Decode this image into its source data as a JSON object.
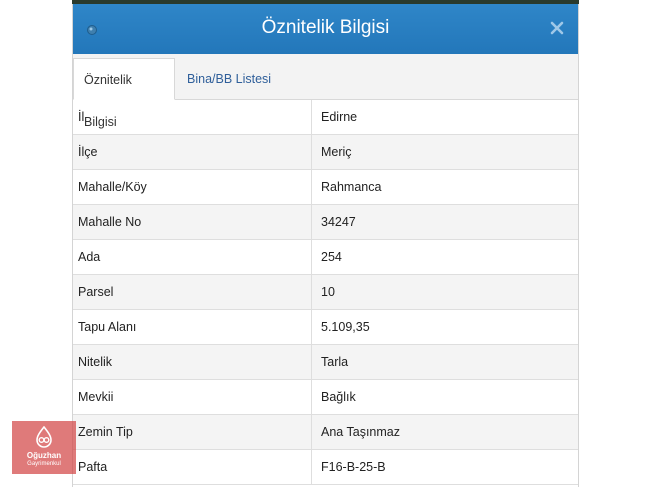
{
  "dialog": {
    "title": "Öznitelik Bilgisi",
    "close_icon": "close-icon",
    "title_icon": "globe-icon",
    "accent_color": "#2a7cbf"
  },
  "tabs": [
    {
      "label": "Öznitelik Bilgisi",
      "active": true
    },
    {
      "label": "Bina/BB Listesi",
      "active": false
    }
  ],
  "attributes": [
    {
      "key": "İl",
      "value": "Edirne"
    },
    {
      "key": "İlçe",
      "value": "Meriç"
    },
    {
      "key": "Mahalle/Köy",
      "value": "Rahmanca"
    },
    {
      "key": "Mahalle No",
      "value": "34247"
    },
    {
      "key": "Ada",
      "value": "254"
    },
    {
      "key": "Parsel",
      "value": "10"
    },
    {
      "key": "Tapu Alanı",
      "value": "5.109,35"
    },
    {
      "key": "Nitelik",
      "value": "Tarla"
    },
    {
      "key": "Mevkii",
      "value": "Bağlık"
    },
    {
      "key": "Zemin Tip",
      "value": "Ana Taşınmaz"
    },
    {
      "key": "Pafta",
      "value": "F16-B-25-B"
    }
  ],
  "watermark": {
    "line1": "Oğuzhan",
    "line2": "Gayrimenkul"
  }
}
